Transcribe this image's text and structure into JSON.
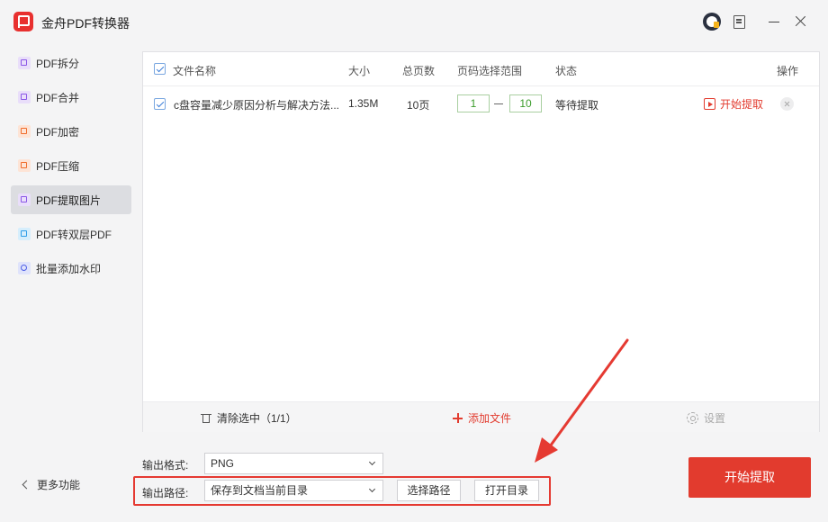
{
  "app": {
    "title": "金舟PDF转换器"
  },
  "sidebar": {
    "items": [
      {
        "label": "PDF拆分"
      },
      {
        "label": "PDF合并"
      },
      {
        "label": "PDF加密"
      },
      {
        "label": "PDF压缩"
      },
      {
        "label": "PDF提取图片"
      },
      {
        "label": "PDF转双层PDF"
      },
      {
        "label": "批量添加水印"
      }
    ],
    "active": "PDF提取图片",
    "more_label": "更多功能"
  },
  "table": {
    "headers": {
      "name": "文件名称",
      "size": "大小",
      "pages": "总页数",
      "range": "页码选择范围",
      "status": "状态",
      "action": "操作"
    },
    "rows": [
      {
        "checked": true,
        "name": "c盘容量减少原因分析与解决方法...",
        "size": "1.35M",
        "pages": "10页",
        "range_from": "1",
        "range_to": "10",
        "status": "等待提取",
        "action": "开始提取"
      }
    ]
  },
  "bottom_bar": {
    "clear_label": "清除选中（1/1）",
    "add_label": "添加文件",
    "settings_label": "设置"
  },
  "output": {
    "format_label": "输出格式:",
    "format_value": "PNG",
    "path_label": "输出路径:",
    "path_value": "保存到文档当前目录",
    "choose_path_label": "选择路径",
    "open_dir_label": "打开目录"
  },
  "start_button_label": "开始提取",
  "icons": {
    "logo": "app-logo-icon",
    "user": "user-icon",
    "note": "feedback-icon",
    "minimize": "minimize-icon",
    "close": "close-icon",
    "trash": "trash-icon",
    "plus": "plus-icon",
    "gear": "gear-icon",
    "play": "play-icon"
  },
  "colors": {
    "accent": "#e23b2e",
    "annotation": "#e53a32",
    "page_input": "#3c9c2c"
  }
}
